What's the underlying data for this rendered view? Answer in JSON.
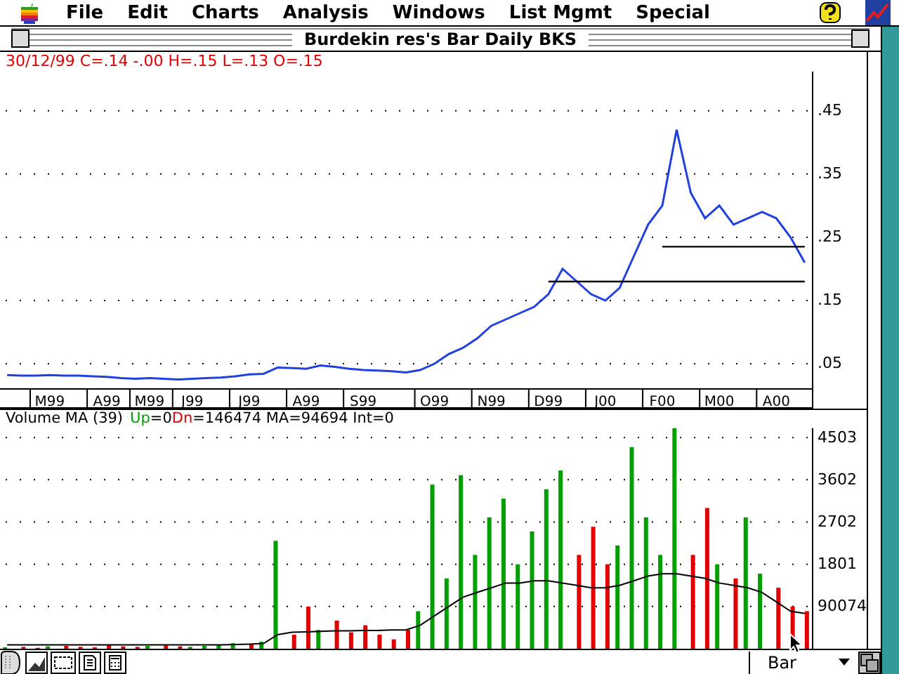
{
  "menubar": {
    "items": [
      "File",
      "Edit",
      "Charts",
      "Analysis",
      "Windows",
      "List Mgmt",
      "Special"
    ]
  },
  "window": {
    "title": "Burdekin res's Bar Daily BKS"
  },
  "quote_line": "30/12/99 C=.14 -.00 H=.15 L=.13 O=.15",
  "price_chart": {
    "chart_data": {
      "type": "line",
      "grid": true,
      "categories": [
        null,
        null,
        null,
        "M99",
        null,
        null,
        null,
        "A99",
        null,
        null,
        "M99",
        null,
        null,
        "J99",
        null,
        null,
        null,
        "J99",
        null,
        null,
        null,
        "A99",
        null,
        null,
        null,
        "S99",
        null,
        null,
        null,
        null,
        "O99",
        null,
        null,
        null,
        "N99",
        null,
        null,
        null,
        "D99",
        null,
        null,
        null,
        "J00",
        null,
        null,
        null,
        "F00",
        null,
        null,
        null,
        "M00",
        null,
        null,
        null,
        "A00",
        null,
        null
      ],
      "series": [
        {
          "color": "#2040e0",
          "values": [
            0.032,
            0.031,
            0.031,
            0.032,
            0.031,
            0.031,
            0.03,
            0.029,
            0.027,
            0.026,
            0.027,
            0.026,
            0.025,
            0.026,
            0.027,
            0.028,
            0.03,
            0.033,
            0.034,
            0.044,
            0.043,
            0.042,
            0.047,
            0.045,
            0.042,
            0.04,
            0.039,
            0.038,
            0.036,
            0.04,
            0.05,
            0.065,
            0.075,
            0.09,
            0.11,
            0.12,
            0.13,
            0.14,
            0.16,
            0.2,
            0.18,
            0.16,
            0.15,
            0.17,
            0.22,
            0.27,
            0.3,
            0.42,
            0.32,
            0.28,
            0.3,
            0.27,
            0.28,
            0.29,
            0.28,
            0.25,
            0.21
          ]
        },
        {
          "color": "#000000",
          "values": [
            null,
            null,
            null,
            null,
            null,
            null,
            null,
            null,
            null,
            null,
            null,
            null,
            null,
            null,
            null,
            null,
            null,
            null,
            null,
            null,
            null,
            null,
            null,
            null,
            null,
            null,
            null,
            null,
            null,
            null,
            null,
            null,
            null,
            null,
            null,
            null,
            null,
            null,
            null,
            null,
            null,
            null,
            null,
            null,
            null,
            null,
            0.235,
            0.235,
            0.235,
            0.235,
            0.235,
            0.235,
            0.235,
            0.235,
            0.235,
            0.235,
            0.235
          ]
        },
        {
          "color": "#000000",
          "values": [
            null,
            null,
            null,
            null,
            null,
            null,
            null,
            null,
            null,
            null,
            null,
            null,
            null,
            null,
            null,
            null,
            null,
            null,
            null,
            null,
            null,
            null,
            null,
            null,
            null,
            null,
            null,
            null,
            null,
            null,
            null,
            null,
            null,
            null,
            null,
            null,
            null,
            null,
            0.18,
            0.18,
            0.18,
            0.18,
            0.18,
            0.18,
            0.18,
            0.18,
            0.18,
            0.18,
            0.18,
            0.18,
            0.18,
            0.18,
            0.18,
            0.18,
            0.18,
            0.18,
            0.18
          ]
        }
      ],
      "ylim": [
        0.01,
        0.512
      ],
      "yticks": [
        {
          "value": 0.05,
          "label": ".05"
        },
        {
          "value": 0.15,
          "label": ".15"
        },
        {
          "value": 0.25,
          "label": ".25"
        },
        {
          "value": 0.35,
          "label": ".35"
        },
        {
          "value": 0.45,
          "label": ".45"
        }
      ]
    }
  },
  "volume_legend": [
    {
      "text": "Volume MA (39)",
      "color": "#000000"
    },
    {
      "text": "Up",
      "color": "#00a000"
    },
    {
      "text": "=0",
      "color": "#000000"
    },
    {
      "text": "Dn",
      "color": "#e00000"
    },
    {
      "text": "=146474 MA=94694 Int=0",
      "color": "#000000"
    }
  ],
  "volume_chart": {
    "chart_data": {
      "type": "bar",
      "grid": true,
      "stacked": false,
      "categories": [
        null,
        null,
        null,
        null,
        null,
        null,
        null,
        null,
        null,
        null,
        null,
        null,
        null,
        null,
        null,
        null,
        null,
        null,
        null,
        null,
        null,
        null,
        null,
        null,
        null,
        null,
        null,
        null,
        null,
        null,
        null,
        null,
        null,
        null,
        null,
        null,
        null,
        null,
        null,
        null,
        null,
        null,
        null,
        null,
        null,
        null,
        null,
        null,
        null,
        null,
        null,
        null,
        null,
        null,
        null,
        null,
        null
      ],
      "series": [
        {
          "color": "#00a000",
          "values": [
            30,
            null,
            null,
            50,
            null,
            null,
            null,
            null,
            null,
            null,
            60,
            null,
            null,
            40,
            60,
            90,
            120,
            null,
            150,
            2300,
            null,
            null,
            400,
            null,
            null,
            null,
            null,
            null,
            null,
            800,
            3500,
            1500,
            3700,
            2000,
            2800,
            3200,
            1800,
            2500,
            3400,
            3800,
            null,
            null,
            null,
            2200,
            4300,
            2800,
            2000,
            4700,
            null,
            null,
            1800,
            null,
            2800,
            1600,
            null,
            null,
            null
          ]
        },
        {
          "color": "#e00000",
          "values": [
            null,
            40,
            20,
            null,
            60,
            40,
            30,
            80,
            50,
            40,
            null,
            70,
            50,
            null,
            null,
            null,
            null,
            100,
            null,
            null,
            300,
            900,
            null,
            600,
            350,
            500,
            300,
            200,
            400,
            null,
            null,
            null,
            null,
            null,
            null,
            null,
            null,
            null,
            null,
            null,
            2000,
            2600,
            1800,
            null,
            null,
            null,
            null,
            null,
            2000,
            3000,
            null,
            1500,
            null,
            null,
            1300,
            900,
            800
          ]
        },
        {
          "type": "line",
          "color": "#000000",
          "values": [
            80,
            80,
            80,
            80,
            80,
            80,
            80,
            80,
            80,
            80,
            80,
            80,
            80,
            80,
            80,
            80,
            90,
            100,
            110,
            300,
            350,
            360,
            370,
            380,
            380,
            390,
            390,
            400,
            400,
            500,
            700,
            900,
            1100,
            1200,
            1300,
            1400,
            1400,
            1450,
            1450,
            1400,
            1350,
            1300,
            1300,
            1350,
            1450,
            1550,
            1600,
            1600,
            1550,
            1500,
            1400,
            1350,
            1300,
            1200,
            1000,
            800,
            750
          ]
        }
      ],
      "ylim": [
        0,
        4700
      ],
      "yticks": [
        1801,
        2702,
        3602,
        4503
      ]
    },
    "low_tick_label": "90074"
  },
  "bottom_bar": {
    "chart_style": "Bar"
  }
}
